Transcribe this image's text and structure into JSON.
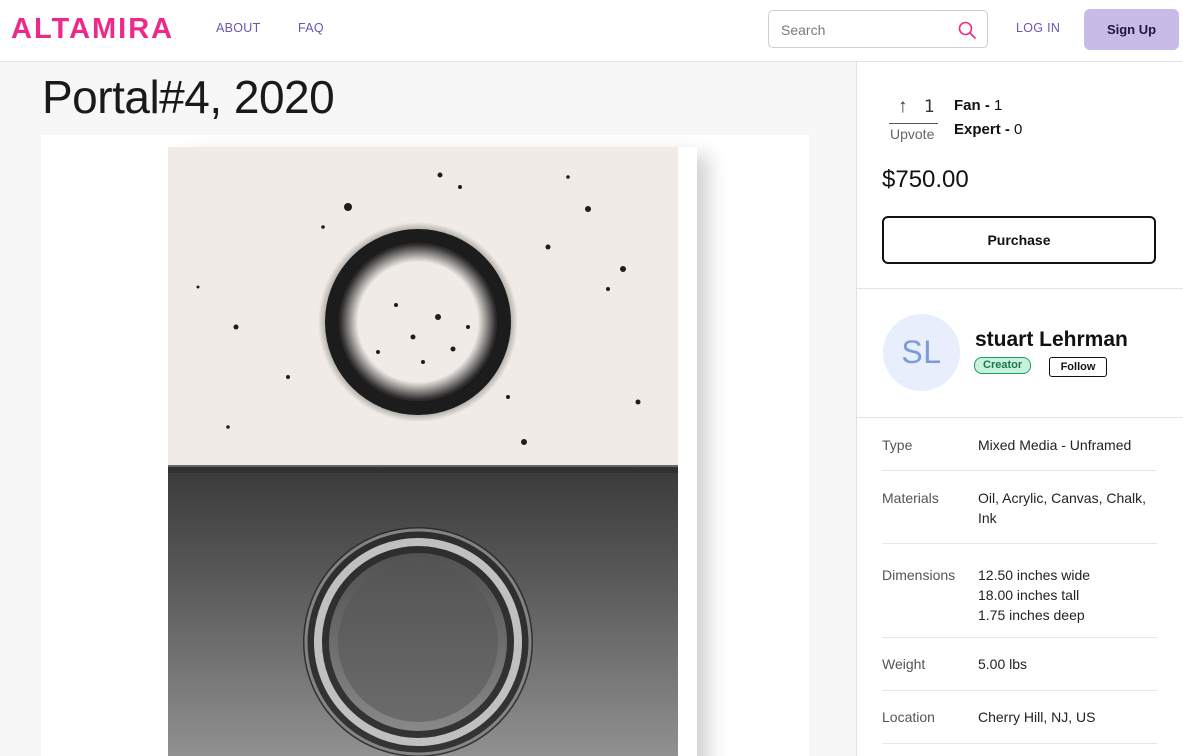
{
  "header": {
    "logo": "ALTAMIRA",
    "nav": {
      "about": "ABOUT",
      "faq": "FAQ"
    },
    "search": {
      "placeholder": "Search",
      "value": ""
    },
    "login": "LOG IN",
    "signup": "Sign Up"
  },
  "artwork": {
    "title": "Portal#4, 2020"
  },
  "votes": {
    "upvote_label": "Upvote",
    "upvote_count": "1",
    "fan_label": "Fan - ",
    "fan_count": "1",
    "expert_label": "Expert - ",
    "expert_count": "0"
  },
  "price": "$750.00",
  "purchase_label": "Purchase",
  "creator": {
    "initials": "SL",
    "name": "stuart Lehrman",
    "badge": "Creator",
    "follow": "Follow"
  },
  "details": {
    "type": {
      "label": "Type",
      "value": "Mixed Media - Unframed"
    },
    "materials": {
      "label": "Materials",
      "value1": "Oil, Acrylic, Canvas, Chalk,",
      "value2": "Ink"
    },
    "dimensions": {
      "label": "Dimensions",
      "wide": "12.50 inches wide",
      "tall": "18.00 inches tall",
      "deep": "1.75 inches deep"
    },
    "weight": {
      "label": "Weight",
      "value": "5.00 lbs"
    },
    "location": {
      "label": "Location",
      "value": "Cherry Hill, NJ, US"
    }
  },
  "colors": {
    "logo": "#ec2a8b",
    "nav_link": "#6d55b0",
    "signup_bg": "#c8bbe8",
    "creator_badge_bg": "#c8f2dc",
    "avatar_bg": "#e8eefb"
  },
  "icons": {
    "search": "search-icon",
    "upvote": "arrow-up-icon"
  }
}
